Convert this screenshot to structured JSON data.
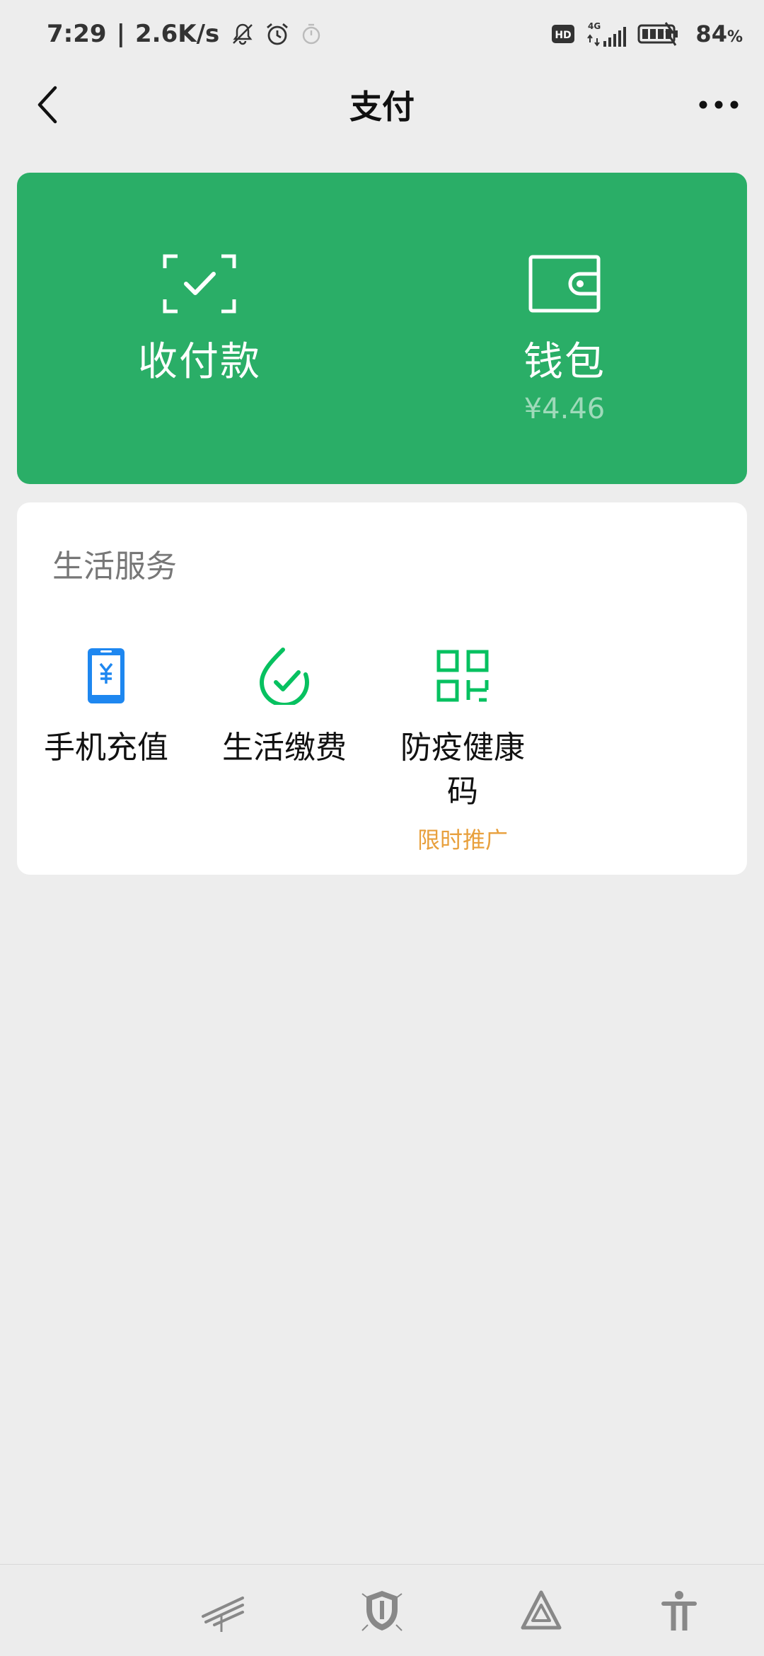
{
  "status_bar": {
    "time": "7:29",
    "separator": "|",
    "net_speed": "2.6K/s",
    "hd_badge": "HD",
    "network_type": "4G",
    "battery_value": "84",
    "battery_unit": "%",
    "icons": [
      "mute-bell-icon",
      "alarm-icon",
      "timer-icon",
      "hd-icon",
      "signal-icon",
      "battery-icon"
    ]
  },
  "nav": {
    "title": "支付",
    "back_icon": "chevron-left-icon",
    "more_icon": "more-dots-icon"
  },
  "pay_card": {
    "background": "#2aae67",
    "receive_pay": {
      "label": "收付款",
      "icon": "scan-check-icon"
    },
    "wallet": {
      "label": "钱包",
      "balance": "¥4.46",
      "icon": "wallet-icon"
    }
  },
  "services": {
    "title": "生活服务",
    "items": [
      {
        "label": "手机充值",
        "icon": "phone-yuan-icon",
        "color": "#1e87f0"
      },
      {
        "label": "生活缴费",
        "icon": "drop-check-icon",
        "color": "#07c160"
      },
      {
        "label": "防疫健康码",
        "icon": "qr-code-icon",
        "color": "#07c160",
        "promo": "限时推广"
      }
    ],
    "promo_color": "#e8a03d"
  },
  "bottom_nav": {
    "icons": [
      "swipe-lines-icon",
      "shield-icon",
      "triangle-icon",
      "accessibility-icon"
    ]
  }
}
